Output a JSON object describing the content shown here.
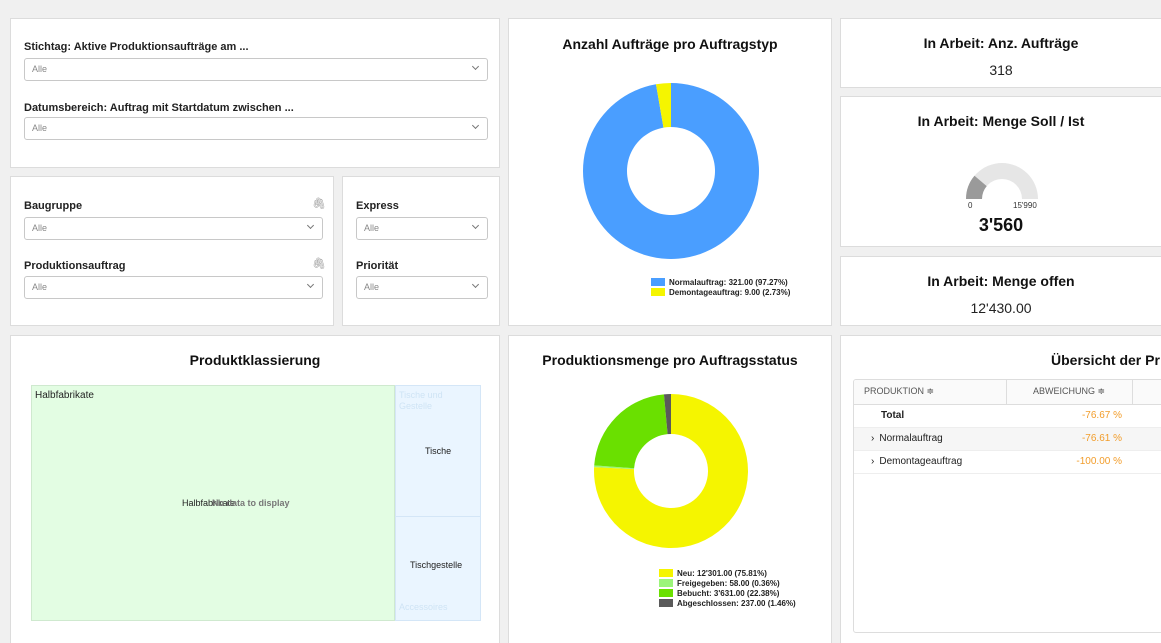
{
  "filters": {
    "stichtag_label": "Stichtag: Aktive Produktionsaufträge am ...",
    "stichtag_value": "Alle",
    "datum_label": "Datumsbereich: Auftrag mit Startdatum zwischen ...",
    "datum_value": "Alle",
    "baugruppe_label": "Baugruppe",
    "baugruppe_value": "Alle",
    "produktionsauftrag_label": "Produktionsauftrag",
    "produktionsauftrag_value": "Alle",
    "express_label": "Express",
    "express_value": "Alle",
    "prioritaet_label": "Priorität",
    "prioritaet_value": "Alle"
  },
  "donut1": {
    "title": "Anzahl Aufträge pro Auftragstyp",
    "legend": [
      {
        "label": "Normalauftrag: 321.00 (97.27%)",
        "color": "#4a9eff"
      },
      {
        "label": "Demontageauftrag: 9.00 (2.73%)",
        "color": "#f5f500"
      }
    ]
  },
  "kpi1": {
    "title": "In Arbeit: Anz. Aufträge",
    "value": "318"
  },
  "kpi2": {
    "title": "In Arbeit: Menge Soll / Ist",
    "gauge_min": "0",
    "gauge_max": "15'990",
    "value": "3'560",
    "fraction": 0.223
  },
  "kpi3": {
    "title": "In Arbeit: Menge offen",
    "value": "12'430.00"
  },
  "treemap": {
    "title": "Produktklassierung",
    "halbfabrikate": "Halbfabrikate",
    "center_text": "Halbfabrikate",
    "overlay_text": "No data to display",
    "faded_top": "Tische und Gestelle",
    "tische": "Tische",
    "tischgestelle": "Tischgestelle",
    "faded_bottom": "Accessoires"
  },
  "donut2": {
    "title": "Produktionsmenge pro Auftragsstatus",
    "legend": [
      {
        "label": "Neu: 12'301.00 (75.81%)",
        "color": "#f5f500"
      },
      {
        "label": "Freigegeben: 58.00 (0.36%)",
        "color": "#9cf57a"
      },
      {
        "label": "Bebucht: 3'631.00 (22.38%)",
        "color": "#6ae000"
      },
      {
        "label": "Abgeschlossen: 237.00 (1.46%)",
        "color": "#5a5a5a"
      }
    ]
  },
  "overview": {
    "title": "Übersicht der Pr",
    "col_produktion": "PRODUKTION ≑",
    "col_abweichung": "ABWEICHUNG ≑",
    "rows": [
      {
        "name": "Total",
        "value": "-76.67 %"
      },
      {
        "name": "Normalauftrag",
        "value": "-76.61 %"
      },
      {
        "name": "Demontageauftrag",
        "value": "-100.00 %"
      }
    ]
  },
  "chart_data": [
    {
      "type": "pie",
      "title": "Anzahl Aufträge pro Auftragstyp",
      "categories": [
        "Normalauftrag",
        "Demontageauftrag"
      ],
      "values": [
        321.0,
        9.0
      ]
    },
    {
      "type": "pie",
      "title": "Produktionsmenge pro Auftragsstatus",
      "categories": [
        "Neu",
        "Freigegeben",
        "Bebucht",
        "Abgeschlossen"
      ],
      "values": [
        12301.0,
        58.0,
        3631.0,
        237.0
      ]
    }
  ]
}
